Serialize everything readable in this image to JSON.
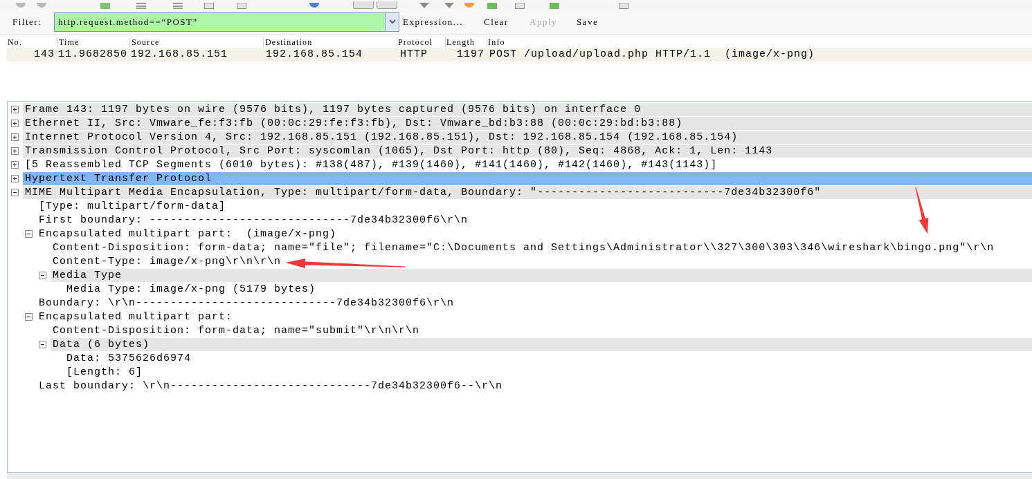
{
  "filter_bar": {
    "label": "Filter:",
    "value": "http.request.method==“POST”",
    "buttons": [
      {
        "label": "Expression...",
        "disabled": false
      },
      {
        "label": "Clear",
        "disabled": false
      },
      {
        "label": "Apply",
        "disabled": true
      },
      {
        "label": "Save",
        "disabled": false
      }
    ]
  },
  "packet_list": {
    "columns": [
      "No.",
      "Time",
      "Source",
      "Destination",
      "Protocol",
      "Length",
      "Info"
    ],
    "rows": [
      {
        "cells": [
          "143",
          "11.9682850",
          "192.168.85.151",
          "192.168.85.154",
          "HTTP",
          "1197",
          "POST /upload/upload.php HTTP/1.1  (image/x-png)"
        ]
      }
    ]
  },
  "packet_details": {
    "tree": [
      {
        "text": "Frame 143: 1197 bytes on wire (9576 bits), 1197 bytes captured (9576 bits) on interface 0",
        "expanded": false,
        "selected": false,
        "shaded": true
      },
      {
        "text": "Ethernet II, Src: Vmware_fe:f3:fb (00:0c:29:fe:f3:fb), Dst: Vmware_bd:b3:88 (00:0c:29:bd:b3:88)",
        "expanded": false,
        "selected": false,
        "shaded": true
      },
      {
        "text": "Internet Protocol Version 4, Src: 192.168.85.151 (192.168.85.151), Dst: 192.168.85.154 (192.168.85.154)",
        "expanded": false,
        "selected": false,
        "shaded": true
      },
      {
        "text": "Transmission Control Protocol, Src Port: syscomlan (1065), Dst Port: http (80), Seq: 4868, Ack: 1, Len: 1143",
        "expanded": false,
        "selected": false,
        "shaded": true
      },
      {
        "text": "[5 Reassembled TCP Segments (6010 bytes): #138(487), #139(1460), #141(1460), #142(1460), #143(1143)]",
        "expanded": false,
        "selected": false,
        "shaded": false
      },
      {
        "text": "Hypertext Transfer Protocol",
        "expanded": false,
        "selected": true
      },
      {
        "text": "MIME Multipart Media Encapsulation, Type: multipart/form-data, Boundary: \"---------------------------7de34b32300f6\"",
        "expanded": true,
        "selected": false,
        "shaded": true,
        "children": [
          {
            "text": "[Type: multipart/form-data]",
            "selected": false,
            "shaded": false
          },
          {
            "text": "First boundary: -----------------------------7de34b32300f6\\r\\n",
            "selected": false,
            "shaded": false
          },
          {
            "text": "Encapsulated multipart part:  (image/x-png)",
            "expanded": true,
            "selected": false,
            "shaded": false,
            "children": [
              {
                "text": "Content-Disposition: form-data; name=\"file\"; filename=\"C:\\Documents and Settings\\Administrator\\\\327\\300\\303\\346\\wireshark\\bingo.png\"\\r\\n",
                "selected": false,
                "shaded": false
              },
              {
                "text": "Content-Type: image/x-png\\r\\n\\r\\n",
                "selected": false,
                "shaded": false
              },
              {
                "text": "Media Type",
                "expanded": true,
                "selected": false,
                "shaded": true,
                "children": [
                  {
                    "text": "Media Type: image/x-png (5179 bytes)",
                    "selected": false,
                    "shaded": false
                  }
                ]
              }
            ]
          },
          {
            "text": "Boundary: \\r\\n-----------------------------7de34b32300f6\\r\\n",
            "selected": false,
            "shaded": false
          },
          {
            "text": "Encapsulated multipart part:",
            "expanded": true,
            "selected": false,
            "shaded": false,
            "children": [
              {
                "text": "Content-Disposition: form-data; name=\"submit\"\\r\\n\\r\\n",
                "selected": false,
                "shaded": false
              },
              {
                "text": "Data (6 bytes)",
                "expanded": true,
                "selected": false,
                "shaded": true,
                "children": [
                  {
                    "text": "Data: 5375626d6974",
                    "selected": false,
                    "shaded": false
                  },
                  {
                    "text": "[Length: 6]",
                    "selected": false,
                    "shaded": false
                  }
                ]
              }
            ]
          },
          {
            "text": "Last boundary: \\r\\n-----------------------------7de34b32300f6--\\r\\n",
            "selected": false,
            "shaded": false
          }
        ]
      }
    ]
  }
}
